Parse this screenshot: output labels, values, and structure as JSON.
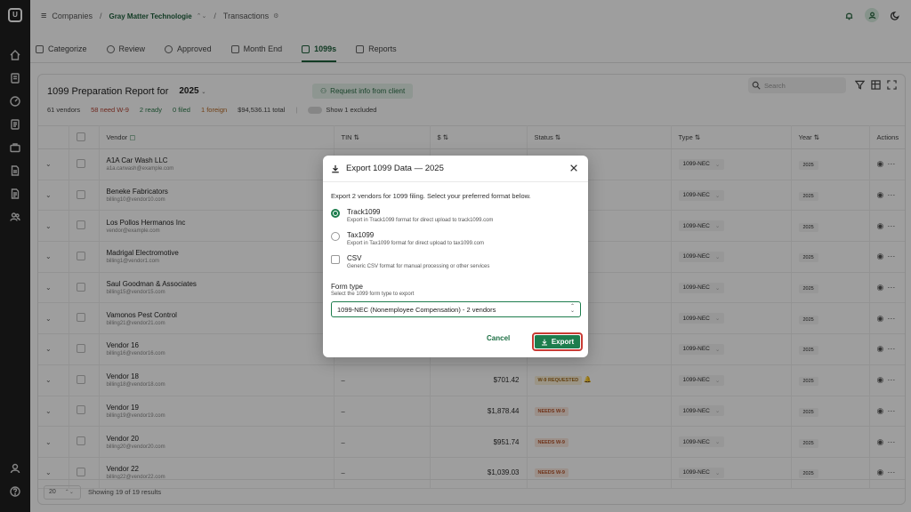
{
  "breadcrumb": {
    "companies": "Companies",
    "client": "Gray Matter Technologie",
    "section": "Transactions"
  },
  "tabs": [
    {
      "label": "Categorize",
      "icon": "categorize-icon"
    },
    {
      "label": "Review",
      "icon": "review-icon"
    },
    {
      "label": "Approved",
      "icon": "approved-icon"
    },
    {
      "label": "Month End",
      "icon": "calendar-icon"
    },
    {
      "label": "1099s",
      "icon": "document-icon",
      "active": true
    },
    {
      "label": "Reports",
      "icon": "reports-icon"
    }
  ],
  "report": {
    "title": "1099 Preparation Report for",
    "year": "2025",
    "request_button": "Request info from client",
    "search_placeholder": "Search",
    "stats": {
      "vendors": "61 vendors",
      "need_w9": "58 need W-9",
      "ready": "2 ready",
      "filed": "0 filed",
      "foreign": "1 foreign",
      "total": "$94,536.11 total",
      "excluded": "Show 1 excluded"
    }
  },
  "columns": {
    "vendor": "Vendor",
    "tin": "TIN ⇅",
    "amount": "$ ⇅",
    "status": "Status ⇅",
    "type": "Type ⇅",
    "year": "Year ⇅",
    "actions": "Actions"
  },
  "rows": [
    {
      "name": "A1A Car Wash LLC",
      "email": "a1a.carwash@example.com",
      "tin": "",
      "amount": "",
      "status": "",
      "type": "1099-NEC",
      "year": "2025"
    },
    {
      "name": "Beneke Fabricators",
      "email": "billing10@vendor10.com",
      "tin": "",
      "amount": "",
      "status": "",
      "type": "1099-NEC",
      "year": "2025"
    },
    {
      "name": "Los Pollos Hermanos Inc",
      "email": "vendor@example.com",
      "tin": "",
      "amount": "",
      "status": "",
      "type": "1099-NEC",
      "year": "2025"
    },
    {
      "name": "Madrigal Electromotive",
      "email": "billing1@vendor1.com",
      "tin": "",
      "amount": "",
      "status": "",
      "type": "1099-NEC",
      "year": "2025"
    },
    {
      "name": "Saul Goodman & Associates",
      "email": "billing15@vendor15.com",
      "tin": "",
      "amount": "",
      "status": "",
      "type": "1099-NEC",
      "year": "2025"
    },
    {
      "name": "Vamonos Pest Control",
      "email": "billing21@vendor21.com",
      "tin": "",
      "amount": "",
      "status": "",
      "type": "1099-NEC",
      "year": "2025"
    },
    {
      "name": "Vendor 16",
      "email": "billing16@vendor16.com",
      "tin": "",
      "amount": "",
      "status": "",
      "type": "1099-NEC",
      "year": "2025"
    },
    {
      "name": "Vendor 18",
      "email": "billing18@vendor18.com",
      "tin": "–",
      "amount": "$701.42",
      "status": "W-9 REQUESTED",
      "status_kind": "req",
      "type": "1099-NEC",
      "year": "2025"
    },
    {
      "name": "Vendor 19",
      "email": "billing19@vendor19.com",
      "tin": "–",
      "amount": "$1,878.44",
      "status": "NEEDS W-9",
      "status_kind": "needs",
      "type": "1099-NEC",
      "year": "2025"
    },
    {
      "name": "Vendor 20",
      "email": "billing20@vendor20.com",
      "tin": "–",
      "amount": "$951.74",
      "status": "NEEDS W-9",
      "status_kind": "needs",
      "type": "1099-NEC",
      "year": "2025"
    },
    {
      "name": "Vendor 22",
      "email": "billing22@vendor22.com",
      "tin": "–",
      "amount": "$1,039.03",
      "status": "NEEDS W-9",
      "status_kind": "needs",
      "type": "1099-NEC",
      "year": "2025"
    }
  ],
  "footer": {
    "page_size": "20",
    "showing": "Showing 19 of 19 results"
  },
  "modal": {
    "title": "Export 1099 Data — 2025",
    "intro": "Export 2 vendors for 1099 filing. Select your preferred format below.",
    "options": [
      {
        "name": "Track1099",
        "desc": "Export in Track1099 format for direct upload to track1099.com",
        "control": "radio",
        "selected": true
      },
      {
        "name": "Tax1099",
        "desc": "Export in Tax1099 format for direct upload to tax1099.com",
        "control": "radio",
        "selected": false
      },
      {
        "name": "CSV",
        "desc": "Generic CSV format for manual processing or other services",
        "control": "checkbox",
        "selected": false
      }
    ],
    "form_type_label": "Form type",
    "form_type_hint": "Select the 1099 form type to export",
    "form_type_value": "1099-NEC (Nonemployee Compensation) - 2 vendors",
    "cancel_label": "Cancel",
    "export_label": "Export"
  },
  "colors": {
    "brand_green": "#1d7d4d",
    "highlight_red": "#c93b34",
    "rail": "#1f1f1f"
  }
}
